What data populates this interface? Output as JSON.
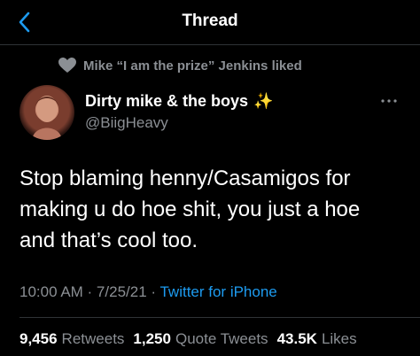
{
  "header": {
    "title": "Thread",
    "back_icon": "chevron-left-icon"
  },
  "social_context": {
    "icon": "heart-icon",
    "text": "Mike “I am the prize” Jenkins liked"
  },
  "author": {
    "name": "Dirty mike & the boys",
    "emoji": "✨",
    "handle": "@BiigHeavy"
  },
  "tweet": {
    "text": "Stop blaming henny/Casamigos for making u do hoe shit, you just a hoe and that’s cool too.",
    "timestamp": "10:00 AM · 7/25/21 · ",
    "source": "Twitter for iPhone"
  },
  "stats": {
    "retweets_count": "9,456",
    "retweets_label": "Retweets",
    "quotes_count": "1,250",
    "quotes_label": "Quote Tweets",
    "likes_count": "43.5K",
    "likes_label": "Likes"
  },
  "colors": {
    "background": "#000000",
    "accent": "#1d9bf0",
    "muted": "#8b8f94"
  }
}
